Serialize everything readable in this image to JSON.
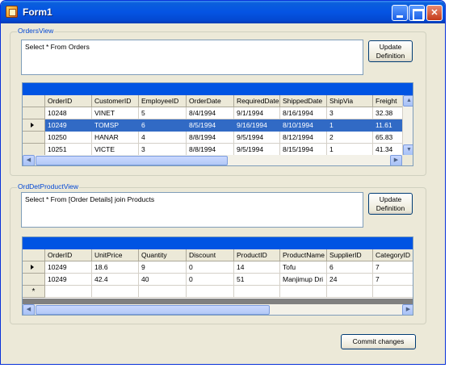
{
  "window": {
    "title": "Form1"
  },
  "orders_group": {
    "title": "OrdersView",
    "query": "Select * From Orders",
    "update_button": [
      "Update",
      "Definition"
    ],
    "columns": [
      "OrderID",
      "CustomerID",
      "EmployeeID",
      "OrderDate",
      "RequiredDate",
      "ShippedDate",
      "ShipVia",
      "Freight"
    ],
    "rows": [
      [
        "10248",
        "VINET",
        "5",
        "8/4/1994",
        "9/1/1994",
        "8/16/1994",
        "3",
        "32.38"
      ],
      [
        "10249",
        "TOMSP",
        "6",
        "8/5/1994",
        "9/16/1994",
        "8/10/1994",
        "1",
        "11.61"
      ],
      [
        "10250",
        "HANAR",
        "4",
        "8/8/1994",
        "9/5/1994",
        "8/12/1994",
        "2",
        "65.83"
      ],
      [
        "10251",
        "VICTE",
        "3",
        "8/8/1994",
        "9/5/1994",
        "8/15/1994",
        "1",
        "41.34"
      ]
    ],
    "selected_row_index": 1
  },
  "details_group": {
    "title": "OrdDetProductView",
    "query": "Select * From [Order Details] join Products",
    "update_button": [
      "Update",
      "Definition"
    ],
    "columns": [
      "OrderID",
      "UnitPrice",
      "Quantity",
      "Discount",
      "ProductID",
      "ProductName",
      "SupplierID",
      "CategoryID"
    ],
    "rows": [
      [
        "10249",
        "18.6",
        "9",
        "0",
        "14",
        "Tofu",
        "6",
        "7"
      ],
      [
        "10249",
        "42.4",
        "40",
        "0",
        "51",
        "Manjimup Dri",
        "24",
        "7"
      ]
    ],
    "new_row_marker": "*"
  },
  "commit_button": "Commit changes"
}
